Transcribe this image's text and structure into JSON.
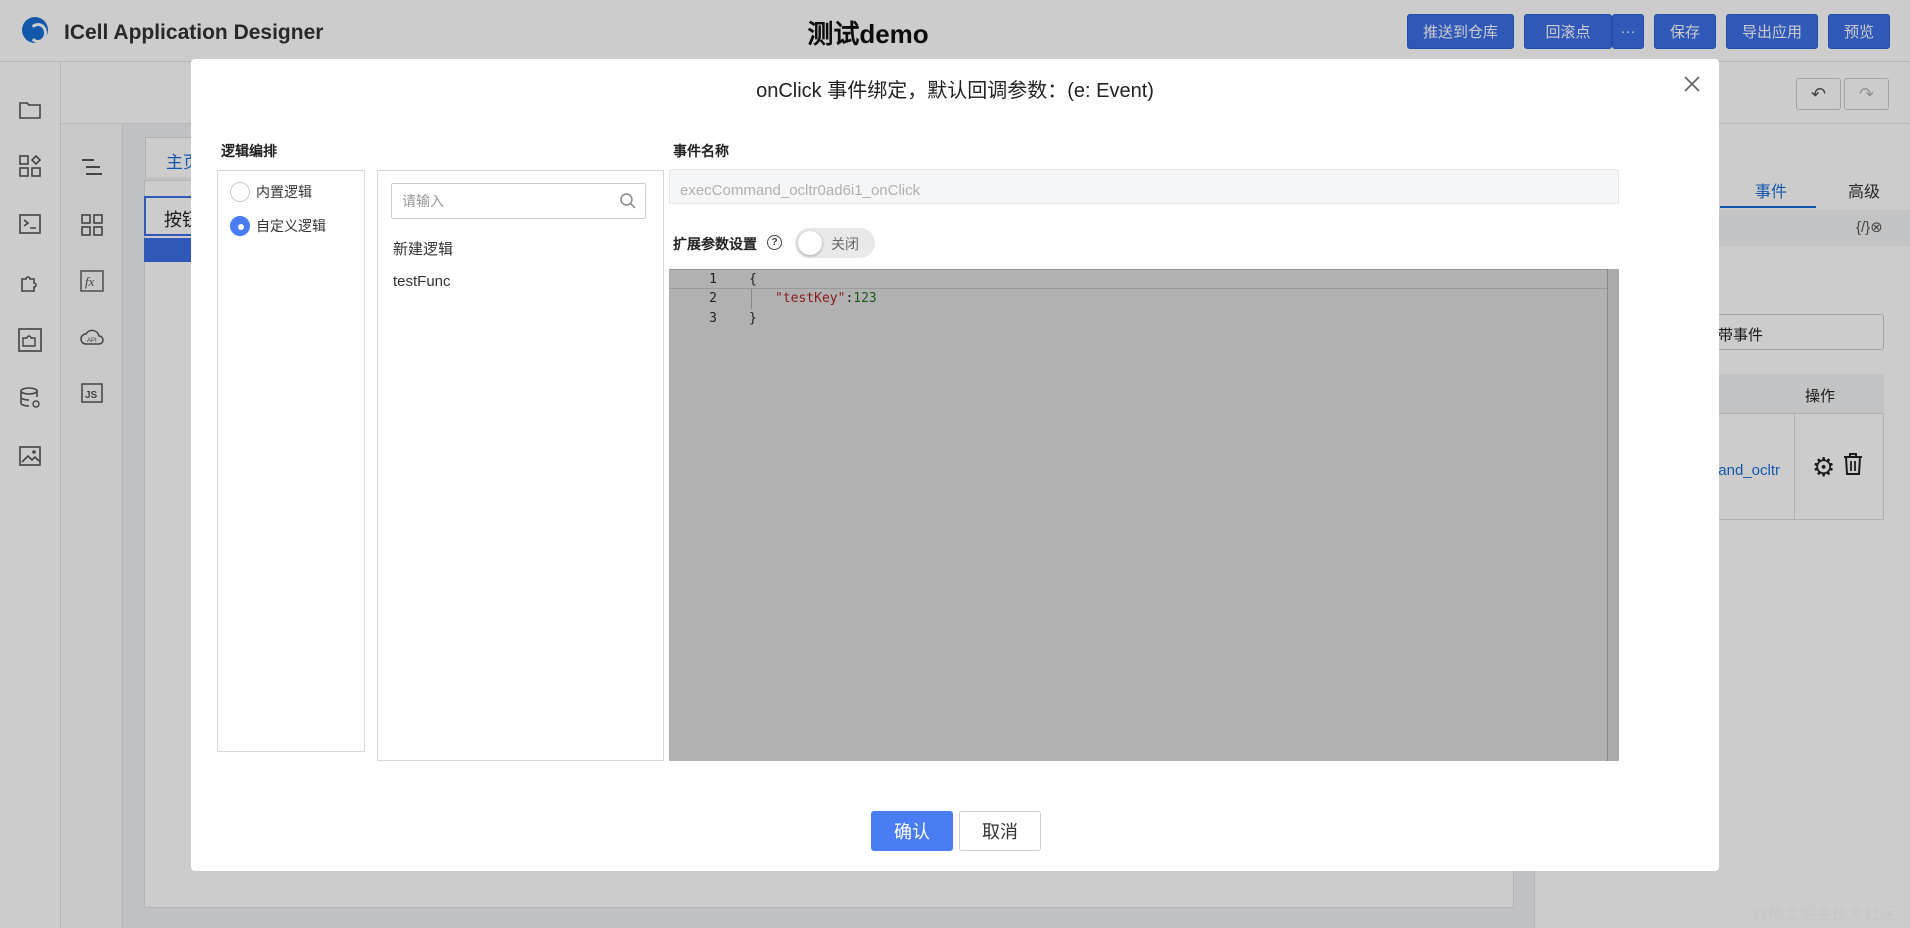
{
  "app": {
    "title": "ICell Application Designer",
    "project_title": "测试demo"
  },
  "toolbar": {
    "push_label": "推送到仓库",
    "rollback_label": "回滚点",
    "more_label": "···",
    "save_label": "保存",
    "export_label": "导出应用",
    "preview_label": "预览"
  },
  "canvas": {
    "page_tab_label": "主页",
    "button_label": "按钮",
    "selected_label": "按"
  },
  "right_panel": {
    "tab_event": "事件",
    "tab_advanced": "高级",
    "code_toggle": "{/}⊗",
    "bind_button_label": "绑带事件",
    "table_header_op": "操作",
    "row_link": "and_ocltr"
  },
  "modal": {
    "title": "onClick 事件绑定，默认回调参数：(e: Event)",
    "logic_section_label": "逻辑编排",
    "radio_builtin_label": "内置逻辑",
    "radio_custom_label": "自定义逻辑",
    "radio_selected": "custom",
    "search_placeholder": "请输入",
    "list_items": [
      "新建逻辑",
      "testFunc"
    ],
    "event_name_label": "事件名称",
    "event_name_value": "execCommand_ocltr0ad6i1_onClick",
    "ext_params_label": "扩展参数设置",
    "toggle_label": "关闭",
    "toggle_on": false,
    "editor_lines": [
      {
        "num": "1",
        "text": "{"
      },
      {
        "num": "2",
        "key": "\"testKey\"",
        "sep": ":",
        "value": "123"
      },
      {
        "num": "3",
        "text": "}"
      }
    ],
    "confirm_label": "确认",
    "cancel_label": "取消"
  },
  "watermark": "@稀土掘金技术社区",
  "colors": {
    "primary": "#4a7df4",
    "toolbar_button": "#3b6fe8",
    "link": "#1a6fd8",
    "editor_bg": "#b1b1b1"
  }
}
